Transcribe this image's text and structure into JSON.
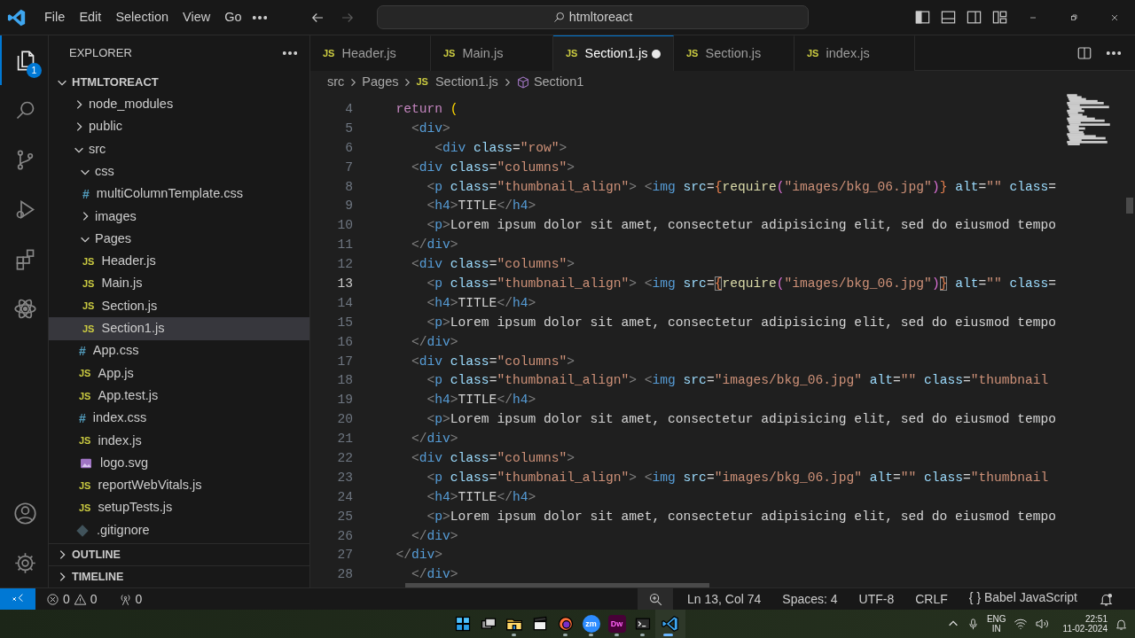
{
  "title_bar": {
    "menus": [
      "File",
      "Edit",
      "Selection",
      "View",
      "Go"
    ],
    "nav": [
      {
        "kind": "back",
        "disabled": false
      },
      {
        "kind": "forward",
        "disabled": true
      }
    ],
    "command_center": "htmltoreact"
  },
  "activity_bar": [
    {
      "kind": "explorer",
      "selected": true,
      "badge": "1"
    },
    {
      "kind": "search",
      "selected": false
    },
    {
      "kind": "source_control",
      "selected": false
    },
    {
      "kind": "run_debug",
      "selected": false
    },
    {
      "kind": "extensions",
      "selected": false
    },
    {
      "kind": "react",
      "selected": false
    }
  ],
  "activity_bar_bottom": [
    {
      "kind": "account"
    },
    {
      "kind": "settings"
    }
  ],
  "explorer": {
    "title": "EXPLORER",
    "root": {
      "kind": "folder",
      "name": "HTMLTOREACT",
      "expanded": true,
      "selected": false,
      "children": [
        {
          "kind": "folder",
          "name": "node_modules",
          "expanded": false,
          "selected": false
        },
        {
          "kind": "folder",
          "name": "public",
          "expanded": false,
          "selected": false
        },
        {
          "kind": "folder",
          "name": "src",
          "expanded": true,
          "selected": false,
          "children": [
            {
              "kind": "folder",
              "name": "css",
              "expanded": true,
              "selected": false,
              "children": [
                {
                  "kind": "css",
                  "badge": "#",
                  "name": "multiColumnTemplate.css",
                  "selected": false
                }
              ]
            },
            {
              "kind": "folder",
              "name": "images",
              "expanded": false,
              "selected": false
            },
            {
              "kind": "folder",
              "name": "Pages",
              "expanded": true,
              "selected": false,
              "children": [
                {
                  "kind": "js",
                  "badge": "JS",
                  "name": "Header.js",
                  "selected": false
                },
                {
                  "kind": "js",
                  "badge": "JS",
                  "name": "Main.js",
                  "selected": false
                },
                {
                  "kind": "js",
                  "badge": "JS",
                  "name": "Section.js",
                  "selected": false
                },
                {
                  "kind": "js",
                  "badge": "JS",
                  "name": "Section1.js",
                  "selected": true
                }
              ]
            },
            {
              "kind": "css",
              "badge": "#",
              "name": "App.css",
              "selected": false
            },
            {
              "kind": "js",
              "badge": "JS",
              "name": "App.js",
              "selected": false
            },
            {
              "kind": "js",
              "badge": "JS",
              "name": "App.test.js",
              "selected": false
            },
            {
              "kind": "css",
              "badge": "#",
              "name": "index.css",
              "selected": false
            },
            {
              "kind": "js",
              "badge": "JS",
              "name": "index.js",
              "selected": false
            },
            {
              "kind": "svg",
              "name": "logo.svg",
              "selected": false
            },
            {
              "kind": "js",
              "badge": "JS",
              "name": "reportWebVitals.js",
              "selected": false
            },
            {
              "kind": "js",
              "badge": "JS",
              "name": "setupTests.js",
              "selected": false
            }
          ]
        },
        {
          "kind": "git",
          "name": ".gitignore",
          "selected": false
        }
      ]
    },
    "sections": [
      {
        "name": "OUTLINE",
        "expanded": false
      },
      {
        "name": "TIMELINE",
        "expanded": false
      }
    ]
  },
  "tabs": [
    {
      "badge": "JS",
      "name": "Header.js",
      "selected": false,
      "modified": false
    },
    {
      "badge": "JS",
      "name": "Main.js",
      "selected": false,
      "modified": false
    },
    {
      "badge": "JS",
      "name": "Section1.js",
      "selected": true,
      "modified": true
    },
    {
      "badge": "JS",
      "name": "Section.js",
      "selected": false,
      "modified": false
    },
    {
      "badge": "JS",
      "name": "index.js",
      "selected": false,
      "modified": false
    }
  ],
  "breadcrumbs": [
    {
      "kind": "folder",
      "text": "src"
    },
    {
      "kind": "folder",
      "text": "Pages"
    },
    {
      "kind": "file",
      "badge": "JS",
      "text": "Section1.js"
    },
    {
      "kind": "symbol",
      "text": "Section1"
    }
  ],
  "editor": {
    "lines": [
      {
        "number": "4",
        "current": false,
        "tokens": [
          {
            "kind": "keyword",
            "text": "  return"
          },
          {
            "kind": "paren",
            "text": " ("
          }
        ]
      },
      {
        "number": "5",
        "current": false,
        "tokens": [
          {
            "kind": "punct",
            "text": "    <"
          },
          {
            "kind": "tag",
            "text": "div"
          },
          {
            "kind": "punct",
            "text": ">"
          }
        ]
      },
      {
        "number": "6",
        "current": false,
        "tokens": [
          {
            "kind": "punct",
            "text": "       <"
          },
          {
            "kind": "tag",
            "text": "div"
          },
          {
            "kind": "attr",
            "text": " class"
          },
          {
            "kind": "text",
            "text": "="
          },
          {
            "kind": "string",
            "text": "\"row\""
          },
          {
            "kind": "punct",
            "text": ">"
          }
        ]
      },
      {
        "number": "7",
        "current": false,
        "tokens": [
          {
            "kind": "punct",
            "text": "    <"
          },
          {
            "kind": "tag",
            "text": "div"
          },
          {
            "kind": "attr",
            "text": " class"
          },
          {
            "kind": "text",
            "text": "="
          },
          {
            "kind": "string",
            "text": "\"columns\""
          },
          {
            "kind": "punct",
            "text": ">"
          }
        ]
      },
      {
        "number": "8",
        "current": false,
        "tokens": [
          {
            "kind": "punct",
            "text": "      <"
          },
          {
            "kind": "tag",
            "text": "p"
          },
          {
            "kind": "attr",
            "text": " class"
          },
          {
            "kind": "text",
            "text": "="
          },
          {
            "kind": "string",
            "text": "\"thumbnail_align\""
          },
          {
            "kind": "punct",
            "text": ">"
          },
          {
            "kind": "punct",
            "text": " <"
          },
          {
            "kind": "tag",
            "text": "img"
          },
          {
            "kind": "attr",
            "text": " src"
          },
          {
            "kind": "text",
            "text": "="
          },
          {
            "kind": "brace",
            "text": "{"
          },
          {
            "kind": "function",
            "text": "require"
          },
          {
            "kind": "paren2",
            "text": "("
          },
          {
            "kind": "string",
            "text": "\"images/bkg_06.jpg\""
          },
          {
            "kind": "paren2",
            "text": ")"
          },
          {
            "kind": "brace",
            "text": "}"
          },
          {
            "kind": "attr",
            "text": " alt"
          },
          {
            "kind": "text",
            "text": "="
          },
          {
            "kind": "string",
            "text": "\"\""
          },
          {
            "kind": "attr",
            "text": " class"
          },
          {
            "kind": "text",
            "text": "="
          }
        ]
      },
      {
        "number": "9",
        "current": false,
        "tokens": [
          {
            "kind": "punct",
            "text": "      <"
          },
          {
            "kind": "tag",
            "text": "h4"
          },
          {
            "kind": "punct",
            "text": ">"
          },
          {
            "kind": "text",
            "text": "TITLE"
          },
          {
            "kind": "punct",
            "text": "</"
          },
          {
            "kind": "tag",
            "text": "h4"
          },
          {
            "kind": "punct",
            "text": ">"
          }
        ]
      },
      {
        "number": "10",
        "current": false,
        "tokens": [
          {
            "kind": "punct",
            "text": "      <"
          },
          {
            "kind": "tag",
            "text": "p"
          },
          {
            "kind": "punct",
            "text": ">"
          },
          {
            "kind": "text",
            "text": "Lorem ipsum dolor sit amet, consectetur adipisicing elit, sed do eiusmod tempo"
          }
        ]
      },
      {
        "number": "11",
        "current": false,
        "tokens": [
          {
            "kind": "punct",
            "text": "    </"
          },
          {
            "kind": "tag",
            "text": "div"
          },
          {
            "kind": "punct",
            "text": ">"
          }
        ]
      },
      {
        "number": "12",
        "current": false,
        "tokens": [
          {
            "kind": "punct",
            "text": "    <"
          },
          {
            "kind": "tag",
            "text": "div"
          },
          {
            "kind": "attr",
            "text": " class"
          },
          {
            "kind": "text",
            "text": "="
          },
          {
            "kind": "string",
            "text": "\"columns\""
          },
          {
            "kind": "punct",
            "text": ">"
          }
        ]
      },
      {
        "number": "13",
        "current": true,
        "tokens": [
          {
            "kind": "punct",
            "text": "      <"
          },
          {
            "kind": "tag",
            "text": "p"
          },
          {
            "kind": "attr",
            "text": " class"
          },
          {
            "kind": "text",
            "text": "="
          },
          {
            "kind": "string",
            "text": "\"thumbnail_align\""
          },
          {
            "kind": "punct",
            "text": ">"
          },
          {
            "kind": "punct",
            "text": " <"
          },
          {
            "kind": "tag",
            "text": "img"
          },
          {
            "kind": "attr",
            "text": " src"
          },
          {
            "kind": "text",
            "text": "="
          },
          {
            "kind": "brace_match",
            "text": "{"
          },
          {
            "kind": "function",
            "text": "require"
          },
          {
            "kind": "paren2",
            "text": "("
          },
          {
            "kind": "string",
            "text": "\"images/bkg_06.jpg\""
          },
          {
            "kind": "paren2",
            "text": ")"
          },
          {
            "kind": "brace_match",
            "text": "}"
          },
          {
            "kind": "attr",
            "text": " alt"
          },
          {
            "kind": "text",
            "text": "="
          },
          {
            "kind": "string",
            "text": "\"\""
          },
          {
            "kind": "attr",
            "text": " class"
          },
          {
            "kind": "text",
            "text": "="
          }
        ]
      },
      {
        "number": "14",
        "current": false,
        "tokens": [
          {
            "kind": "punct",
            "text": "      <"
          },
          {
            "kind": "tag",
            "text": "h4"
          },
          {
            "kind": "punct",
            "text": ">"
          },
          {
            "kind": "text",
            "text": "TITLE"
          },
          {
            "kind": "punct",
            "text": "</"
          },
          {
            "kind": "tag",
            "text": "h4"
          },
          {
            "kind": "punct",
            "text": ">"
          }
        ]
      },
      {
        "number": "15",
        "current": false,
        "tokens": [
          {
            "kind": "punct",
            "text": "      <"
          },
          {
            "kind": "tag",
            "text": "p"
          },
          {
            "kind": "punct",
            "text": ">"
          },
          {
            "kind": "text",
            "text": "Lorem ipsum dolor sit amet, consectetur adipisicing elit, sed do eiusmod tempo"
          }
        ]
      },
      {
        "number": "16",
        "current": false,
        "tokens": [
          {
            "kind": "punct",
            "text": "    </"
          },
          {
            "kind": "tag",
            "text": "div"
          },
          {
            "kind": "punct",
            "text": ">"
          }
        ]
      },
      {
        "number": "17",
        "current": false,
        "tokens": [
          {
            "kind": "punct",
            "text": "    <"
          },
          {
            "kind": "tag",
            "text": "div"
          },
          {
            "kind": "attr",
            "text": " class"
          },
          {
            "kind": "text",
            "text": "="
          },
          {
            "kind": "string",
            "text": "\"columns\""
          },
          {
            "kind": "punct",
            "text": ">"
          }
        ]
      },
      {
        "number": "18",
        "current": false,
        "tokens": [
          {
            "kind": "punct",
            "text": "      <"
          },
          {
            "kind": "tag",
            "text": "p"
          },
          {
            "kind": "attr",
            "text": " class"
          },
          {
            "kind": "text",
            "text": "="
          },
          {
            "kind": "string",
            "text": "\"thumbnail_align\""
          },
          {
            "kind": "punct",
            "text": ">"
          },
          {
            "kind": "punct",
            "text": " <"
          },
          {
            "kind": "tag",
            "text": "img"
          },
          {
            "kind": "attr",
            "text": " src"
          },
          {
            "kind": "text",
            "text": "="
          },
          {
            "kind": "string",
            "text": "\"images/bkg_06.jpg\""
          },
          {
            "kind": "attr",
            "text": " alt"
          },
          {
            "kind": "text",
            "text": "="
          },
          {
            "kind": "string",
            "text": "\"\""
          },
          {
            "kind": "attr",
            "text": " class"
          },
          {
            "kind": "text",
            "text": "="
          },
          {
            "kind": "string",
            "text": "\"thumbnail"
          }
        ]
      },
      {
        "number": "19",
        "current": false,
        "tokens": [
          {
            "kind": "punct",
            "text": "      <"
          },
          {
            "kind": "tag",
            "text": "h4"
          },
          {
            "kind": "punct",
            "text": ">"
          },
          {
            "kind": "text",
            "text": "TITLE"
          },
          {
            "kind": "punct",
            "text": "</"
          },
          {
            "kind": "tag",
            "text": "h4"
          },
          {
            "kind": "punct",
            "text": ">"
          }
        ]
      },
      {
        "number": "20",
        "current": false,
        "tokens": [
          {
            "kind": "punct",
            "text": "      <"
          },
          {
            "kind": "tag",
            "text": "p"
          },
          {
            "kind": "punct",
            "text": ">"
          },
          {
            "kind": "text",
            "text": "Lorem ipsum dolor sit amet, consectetur adipisicing elit, sed do eiusmod tempo"
          }
        ]
      },
      {
        "number": "21",
        "current": false,
        "tokens": [
          {
            "kind": "punct",
            "text": "    </"
          },
          {
            "kind": "tag",
            "text": "div"
          },
          {
            "kind": "punct",
            "text": ">"
          }
        ]
      },
      {
        "number": "22",
        "current": false,
        "tokens": [
          {
            "kind": "punct",
            "text": "    <"
          },
          {
            "kind": "tag",
            "text": "div"
          },
          {
            "kind": "attr",
            "text": " class"
          },
          {
            "kind": "text",
            "text": "="
          },
          {
            "kind": "string",
            "text": "\"columns\""
          },
          {
            "kind": "punct",
            "text": ">"
          }
        ]
      },
      {
        "number": "23",
        "current": false,
        "tokens": [
          {
            "kind": "punct",
            "text": "      <"
          },
          {
            "kind": "tag",
            "text": "p"
          },
          {
            "kind": "attr",
            "text": " class"
          },
          {
            "kind": "text",
            "text": "="
          },
          {
            "kind": "string",
            "text": "\"thumbnail_align\""
          },
          {
            "kind": "punct",
            "text": ">"
          },
          {
            "kind": "punct",
            "text": " <"
          },
          {
            "kind": "tag",
            "text": "img"
          },
          {
            "kind": "attr",
            "text": " src"
          },
          {
            "kind": "text",
            "text": "="
          },
          {
            "kind": "string",
            "text": "\"images/bkg_06.jpg\""
          },
          {
            "kind": "attr",
            "text": " alt"
          },
          {
            "kind": "text",
            "text": "="
          },
          {
            "kind": "string",
            "text": "\"\""
          },
          {
            "kind": "attr",
            "text": " class"
          },
          {
            "kind": "text",
            "text": "="
          },
          {
            "kind": "string",
            "text": "\"thumbnail"
          }
        ]
      },
      {
        "number": "24",
        "current": false,
        "tokens": [
          {
            "kind": "punct",
            "text": "      <"
          },
          {
            "kind": "tag",
            "text": "h4"
          },
          {
            "kind": "punct",
            "text": ">"
          },
          {
            "kind": "text",
            "text": "TITLE"
          },
          {
            "kind": "punct",
            "text": "</"
          },
          {
            "kind": "tag",
            "text": "h4"
          },
          {
            "kind": "punct",
            "text": ">"
          }
        ]
      },
      {
        "number": "25",
        "current": false,
        "tokens": [
          {
            "kind": "punct",
            "text": "      <"
          },
          {
            "kind": "tag",
            "text": "p"
          },
          {
            "kind": "punct",
            "text": ">"
          },
          {
            "kind": "text",
            "text": "Lorem ipsum dolor sit amet, consectetur adipisicing elit, sed do eiusmod tempo"
          }
        ]
      },
      {
        "number": "26",
        "current": false,
        "tokens": [
          {
            "kind": "punct",
            "text": "    </"
          },
          {
            "kind": "tag",
            "text": "div"
          },
          {
            "kind": "punct",
            "text": ">"
          }
        ]
      },
      {
        "number": "27",
        "current": false,
        "tokens": [
          {
            "kind": "punct",
            "text": "  </"
          },
          {
            "kind": "tag",
            "text": "div"
          },
          {
            "kind": "punct",
            "text": ">"
          }
        ]
      },
      {
        "number": "28",
        "current": false,
        "tokens": [
          {
            "kind": "punct",
            "text": "    </"
          },
          {
            "kind": "tag",
            "text": "div"
          },
          {
            "kind": "punct",
            "text": ">"
          }
        ]
      }
    ]
  },
  "status_bar": {
    "errors": "0",
    "warnings": "0",
    "ports": "0",
    "right": [
      {
        "kind": "zoom"
      },
      {
        "kind": "text",
        "text": "Ln 13, Col 74"
      },
      {
        "kind": "text",
        "text": "Spaces: 4"
      },
      {
        "kind": "text",
        "text": "UTF-8"
      },
      {
        "kind": "text",
        "text": "CRLF"
      },
      {
        "kind": "language",
        "icon_text": "{ }",
        "text": "Babel JavaScript"
      },
      {
        "kind": "bell"
      }
    ]
  },
  "taskbar": {
    "apps": [
      {
        "kind": "start",
        "running": false,
        "active": false
      },
      {
        "kind": "task_view",
        "running": false,
        "active": false
      },
      {
        "kind": "folder",
        "running": true,
        "active": false
      },
      {
        "kind": "clapper",
        "running": false,
        "active": false
      },
      {
        "kind": "browser",
        "running": true,
        "active": false
      },
      {
        "kind": "tile",
        "label": "zm",
        "color": "#2d8cff",
        "running": true,
        "active": false
      },
      {
        "kind": "tile",
        "label": "Dw",
        "color": "#470137",
        "running": true,
        "active": false
      },
      {
        "kind": "terminal",
        "running": true,
        "active": false
      },
      {
        "kind": "vscode",
        "running": true,
        "active": true
      }
    ],
    "tray": {
      "language": "ENG",
      "region": "IN",
      "time": "22:51",
      "date": "11-02-2024"
    }
  }
}
